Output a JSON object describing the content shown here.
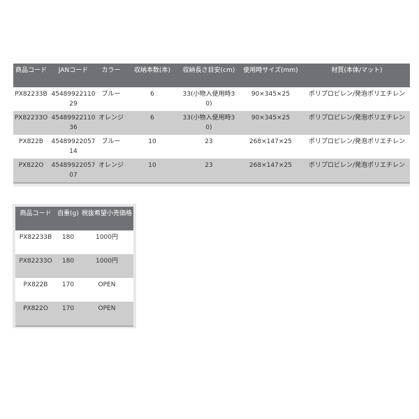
{
  "spec_table": {
    "headers": [
      "商品コード",
      "JANコード",
      "カラー",
      "収納本数(本)",
      "収納長さ目安(cm)",
      "使用時サイズ(mm)",
      "材質(本体/マット)"
    ],
    "rows": [
      [
        "PX82233B",
        "4548992211029",
        "ブルー",
        "6",
        "33(小物入使用時30)",
        "90×345×25",
        "ポリプロピレン/発泡ポリエチレン"
      ],
      [
        "PX82233O",
        "4548992211036",
        "オレンジ",
        "6",
        "33(小物入使用時30)",
        "90×345×25",
        "ポリプロピレン/発泡ポリエチレン"
      ],
      [
        "PX822B",
        "4548992205714",
        "ブルー",
        "10",
        "23",
        "268×147×25",
        "ポリプロピレン/発泡ポリエチレン"
      ],
      [
        "PX822O",
        "4548992205707",
        "オレンジ",
        "10",
        "23",
        "268×147×25",
        "ポリプロピレン/発泡ポリエチレン"
      ]
    ]
  },
  "price_table": {
    "headers": [
      "商品コード",
      "自重(g)",
      "税抜希望小売価格"
    ],
    "rows": [
      [
        "PX82233B",
        "180",
        "1000円"
      ],
      [
        "PX82233O",
        "180",
        "1000円"
      ],
      [
        "PX822B",
        "170",
        "OPEN"
      ],
      [
        "PX822O",
        "170",
        "OPEN"
      ]
    ]
  },
  "colors": {
    "header_bg": "#6e7277",
    "stripe": "#cdcdcd"
  }
}
